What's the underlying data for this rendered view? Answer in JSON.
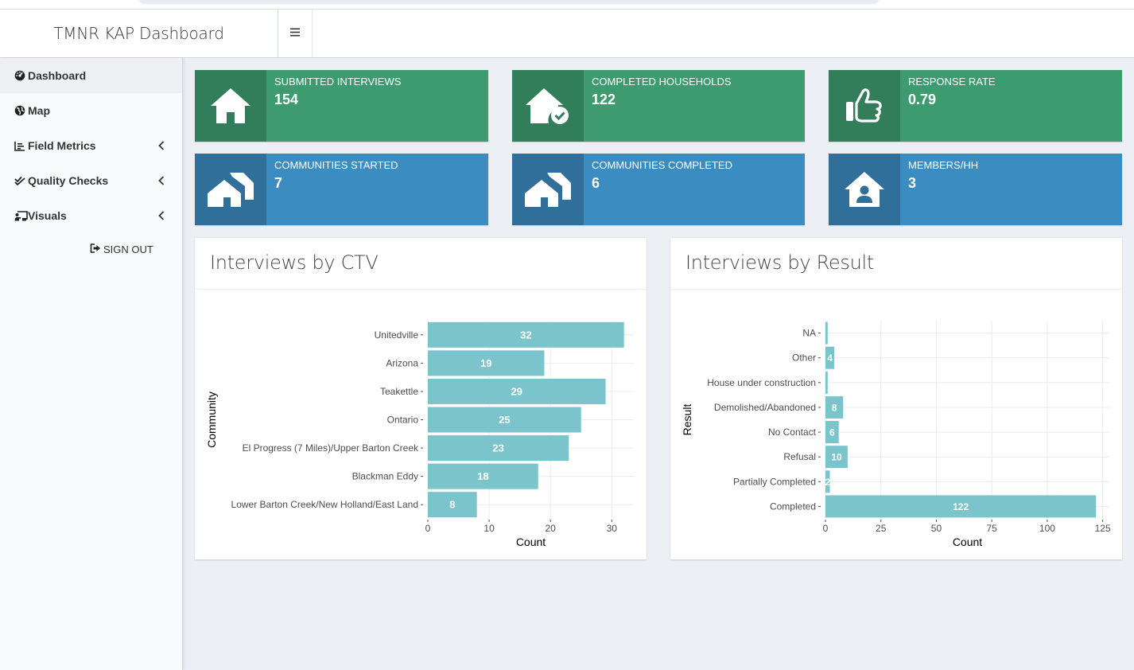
{
  "app": {
    "title": "TMNR KAP Dashboard",
    "menu_toggle_icon": "hamburger-icon"
  },
  "sidebar": {
    "items": [
      {
        "label": "Dashboard",
        "icon": "dashboard-icon",
        "active": true,
        "has_chevron": false
      },
      {
        "label": "Map",
        "icon": "globe-icon",
        "active": false,
        "has_chevron": false
      },
      {
        "label": "Field Metrics",
        "icon": "chart-line-icon",
        "active": false,
        "has_chevron": true
      },
      {
        "label": "Quality Checks",
        "icon": "check-double-icon",
        "active": false,
        "has_chevron": true
      },
      {
        "label": "Visuals",
        "icon": "chalkboard-icon",
        "active": false,
        "has_chevron": true
      }
    ],
    "signout_label": "SIGN OUT"
  },
  "value_boxes": [
    {
      "label": "SUBMITTED INTERVIEWS",
      "value": "154",
      "icon": "house-icon",
      "color": "#3e9b70"
    },
    {
      "label": "COMPLETED HOUSEHOLDS",
      "value": "122",
      "icon": "house-check-icon",
      "color": "#3e9b70"
    },
    {
      "label": "RESPONSE RATE",
      "value": "0.79",
      "icon": "thumbs-up-icon",
      "color": "#3e9b70"
    },
    {
      "label": "COMMUNITIES STARTED",
      "value": "7",
      "icon": "houses-icon",
      "color": "#3b8cc0"
    },
    {
      "label": "COMMUNITIES COMPLETED",
      "value": "6",
      "icon": "houses-icon",
      "color": "#3b8cc0"
    },
    {
      "label": "MEMBERS/HH",
      "value": "3",
      "icon": "house-user-icon",
      "color": "#3b8cc0"
    }
  ],
  "panels": {
    "ctv_title": "Interviews by CTV",
    "result_title": "Interviews by Result"
  },
  "chart_data": [
    {
      "type": "bar",
      "orientation": "horizontal",
      "categories": [
        "Unitedville",
        "Arizona",
        "Teakettle",
        "Ontario",
        "El Progress (7 Miles)/Upper Barton Creek",
        "Blackman Eddy",
        "Lower Barton Creek/New Holland/East Land"
      ],
      "values": [
        32,
        19,
        29,
        25,
        23,
        18,
        8
      ],
      "xlabel": "Count",
      "ylabel": "Community",
      "xlim": [
        0,
        33.6
      ],
      "xticks": [
        0,
        10,
        20,
        30
      ],
      "bar_color": "#7bc4cc",
      "data_labels": true
    },
    {
      "type": "bar",
      "orientation": "horizontal",
      "categories": [
        "NA",
        "Other",
        "House under construction",
        "Demolished/Abandoned",
        "No Contact",
        "Refusal",
        "Partially Completed",
        "Completed"
      ],
      "values": [
        1,
        4,
        1,
        8,
        6,
        10,
        2,
        122
      ],
      "labels": [
        "",
        "4",
        "",
        "8",
        "6",
        "10",
        "2",
        "122"
      ],
      "xlabel": "Count",
      "ylabel": "Result",
      "xlim": [
        0,
        128
      ],
      "xticks": [
        0,
        25,
        50,
        75,
        100,
        125
      ],
      "bar_color": "#7bc4cc",
      "data_labels": true
    }
  ]
}
